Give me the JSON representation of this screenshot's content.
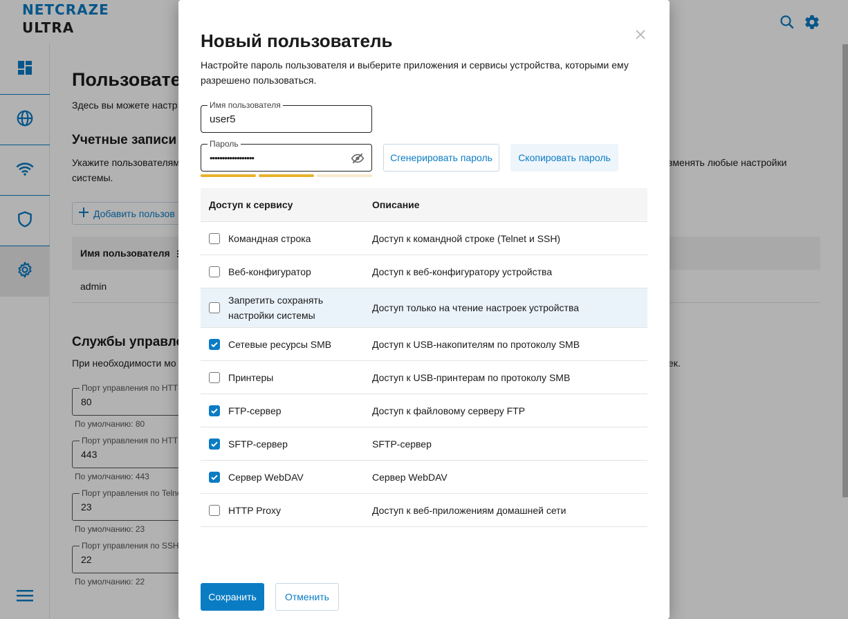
{
  "brand": {
    "line1": "NETCRAZE",
    "line2": "ULTRA",
    "accent": "#0a7cc4"
  },
  "header": {
    "search_icon": "search-icon",
    "settings_icon": "gear-icon"
  },
  "sidebar": {
    "items": [
      {
        "icon": "dashboard-icon"
      },
      {
        "icon": "globe-icon"
      },
      {
        "icon": "wifi-icon"
      },
      {
        "icon": "shield-icon"
      },
      {
        "icon": "gear-icon",
        "active": true
      }
    ],
    "menu_icon": "hamburger-menu-icon"
  },
  "page": {
    "title": "Пользовате",
    "subtitle": "Здесь вы можете настр",
    "accounts": {
      "title": "Учетные записи",
      "text_left": "Укажите пользователям",
      "text_left_2": "системы.",
      "text_right": "зменять любые настройки",
      "add_button": "Добавить пользов",
      "column_username": "Имя пользователя",
      "rows": [
        "admin"
      ]
    },
    "services": {
      "title": "Службы управле",
      "text_left": "При необходимости мо",
      "text_right": "ек.",
      "ports": [
        {
          "label": "Порт управления по HTT",
          "value": "80",
          "hint": "По умолчанию: 80"
        },
        {
          "label": "Порт управления по HTT",
          "value": "443",
          "hint": "По умолчанию: 443"
        },
        {
          "label": "Порт управления по Telne",
          "value": "23",
          "hint": "По умолчанию: 23"
        },
        {
          "label": "Порт управления по SSH",
          "value": "22",
          "hint": "По умолчанию: 22"
        }
      ]
    }
  },
  "modal": {
    "title": "Новый пользователь",
    "description": "Настройте пароль пользователя и выберите приложения и сервисы устройства, которыми ему разрешено пользоваться.",
    "username": {
      "label": "Имя пользователя",
      "value": "user5"
    },
    "password": {
      "label": "Пароль",
      "value": "••••••••••••••••••",
      "strength_segments_filled": 2,
      "strength_segments_total": 3
    },
    "generate_button": "Сгенерировать пароль",
    "copy_button": "Скопировать пароль",
    "table": {
      "col_service": "Доступ к сервису",
      "col_description": "Описание",
      "rows": [
        {
          "service": "Командная строка",
          "description": "Доступ к командной строке (Telnet и SSH)",
          "checked": false
        },
        {
          "service": "Веб-конфигуратор",
          "description": "Доступ к веб-конфигуратору устройства",
          "checked": false
        },
        {
          "service": "Запретить сохранять настройки системы",
          "description": "Доступ только на чтение настроек устройства",
          "checked": false,
          "highlighted": true
        },
        {
          "service": "Сетевые ресурсы SMB",
          "description": "Доступ к USB-накопителям по протоколу SMB",
          "checked": true
        },
        {
          "service": "Принтеры",
          "description": "Доступ к USB-принтерам по протоколу SMB",
          "checked": false
        },
        {
          "service": "FTP-сервер",
          "description": "Доступ к файловому серверу FTP",
          "checked": true
        },
        {
          "service": "SFTP-сервер",
          "description": "SFTP-сервер",
          "checked": true
        },
        {
          "service": "Сервер WebDAV",
          "description": "Сервер WebDAV",
          "checked": true
        },
        {
          "service": "HTTP Proxy",
          "description": "Доступ к веб-приложениям домашней сети",
          "checked": false
        }
      ]
    },
    "save_button": "Сохранить",
    "cancel_button": "Отменить"
  }
}
